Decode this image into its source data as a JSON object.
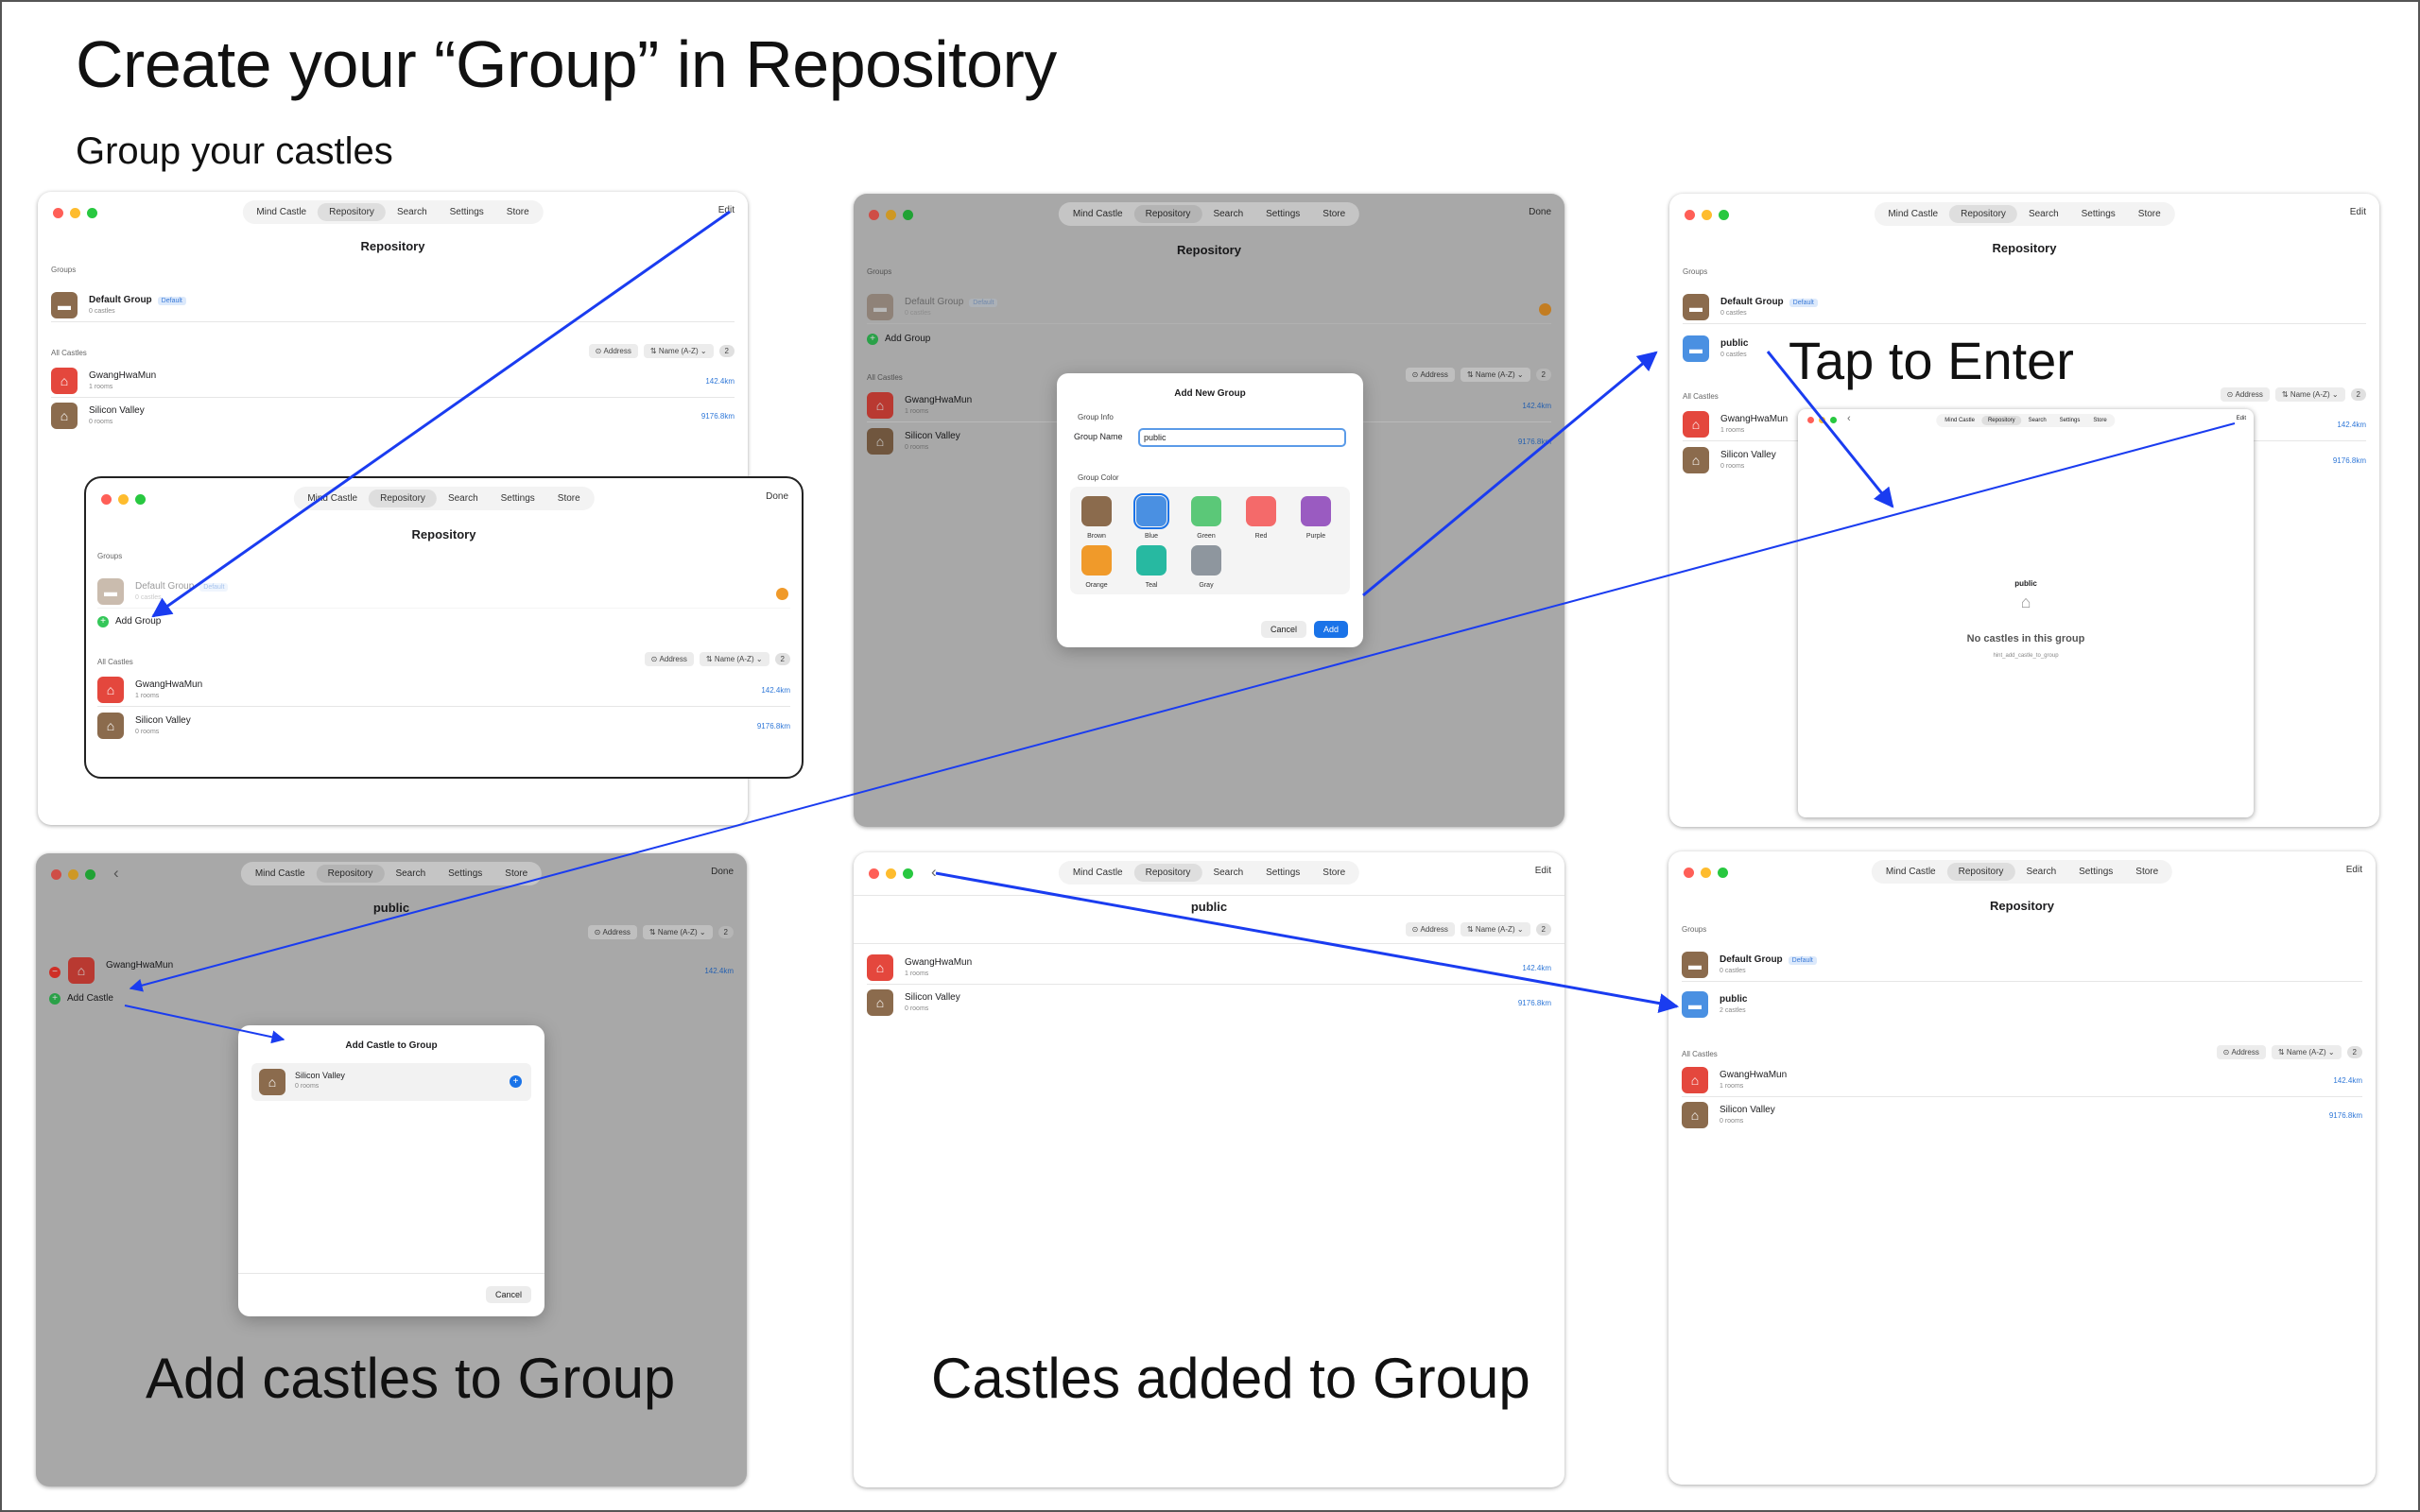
{
  "page": {
    "title": "Create your “Group” in Repository",
    "subtitle": "Group your castles",
    "captions": {
      "tap_to_enter": "Tap to Enter",
      "add_castles": "Add castles to Group",
      "castles_added": "Castles added to Group"
    }
  },
  "nav": {
    "tabs": [
      "Mind Castle",
      "Repository",
      "Search",
      "Settings",
      "Store"
    ],
    "edit": "Edit",
    "done": "Done",
    "back": "‹"
  },
  "repo": {
    "title": "Repository",
    "groups_header": "Groups",
    "all_castles_header": "All Castles",
    "default_group": "Default Group",
    "default_badge": "Default",
    "zero_castles": "0 castles",
    "two_castles": "2 castles",
    "add_group": "Add Group",
    "filter_address": "Address",
    "filter_sort": "Name (A-Z)",
    "count": "2",
    "public_group": "public"
  },
  "castles": [
    {
      "name": "GwangHwaMun",
      "rooms": "1 rooms",
      "distance": "142.4km"
    },
    {
      "name": "Silicon Valley",
      "rooms": "0 rooms",
      "distance": "9176.8km"
    }
  ],
  "new_group_dialog": {
    "title": "Add New Group",
    "section_info": "Group Info",
    "name_label": "Group Name",
    "name_value": "public",
    "section_color": "Group Color",
    "colors": [
      "Brown",
      "Blue",
      "Green",
      "Red",
      "Purple",
      "Orange",
      "Teal",
      "Gray"
    ],
    "cancel": "Cancel",
    "add": "Add"
  },
  "group_detail": {
    "title": "public",
    "empty_title": "No castles in this group",
    "empty_hint": "hint_add_castle_to_group",
    "add_castle": "Add Castle"
  },
  "add_castle_dialog": {
    "title": "Add Castle to Group",
    "castle_name": "Silicon Valley",
    "castle_rooms": "0 rooms",
    "cancel": "Cancel"
  }
}
